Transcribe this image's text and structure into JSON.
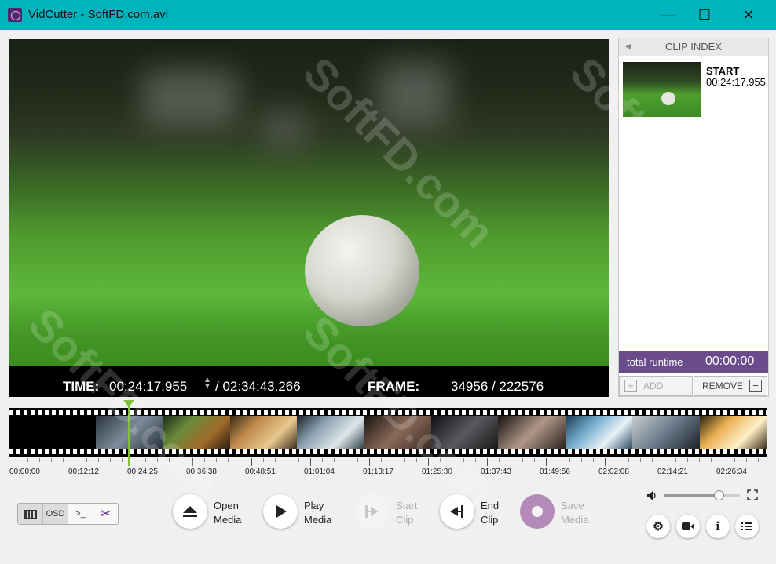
{
  "window": {
    "title": "VidCutter - SoftFD.com.avi",
    "min": "—",
    "max": "☐",
    "close": "✕"
  },
  "info": {
    "time_label": "TIME:",
    "time_value": "00:24:17.955",
    "spinner": "▲\n▼",
    "time_total": "/ 02:34:43.266",
    "frame_label": "FRAME:",
    "frame_value": "34956",
    "frame_total": "/ 222576"
  },
  "clip_index": {
    "header": "CLIP INDEX",
    "collapse_icon": "◀",
    "clips": [
      {
        "label": "START",
        "time": "00:24:17.955"
      }
    ],
    "runtime_label": "total runtime",
    "runtime_value": "00:00:00",
    "add_label": "ADD",
    "remove_label": "REMOVE"
  },
  "timeline": {
    "ticks": [
      "00:00:00",
      "00:12:12",
      "00:24:25",
      "00:36:38",
      "00:48:51",
      "01:01:04",
      "01:13:17",
      "01:25:30",
      "01:37:43",
      "01:49:56",
      "02:02:08",
      "02:14:21",
      "02:26:34"
    ],
    "position": 0.157
  },
  "mode_buttons": {
    "osd": "OSD",
    "console": ">_"
  },
  "controls": {
    "open": {
      "label": "Open\nMedia"
    },
    "play": {
      "label": "Play\nMedia"
    },
    "start": {
      "label": "Start\nClip"
    },
    "end": {
      "label": "End\nClip"
    },
    "save": {
      "label": "Save\nMedia"
    }
  },
  "volume": {
    "level": 0.72
  },
  "watermark": "SoftFD.com",
  "colors": {
    "titlebar": "#00b4be",
    "accent_purple": "#6a4c8c",
    "playhead": "#7fbf3a"
  }
}
